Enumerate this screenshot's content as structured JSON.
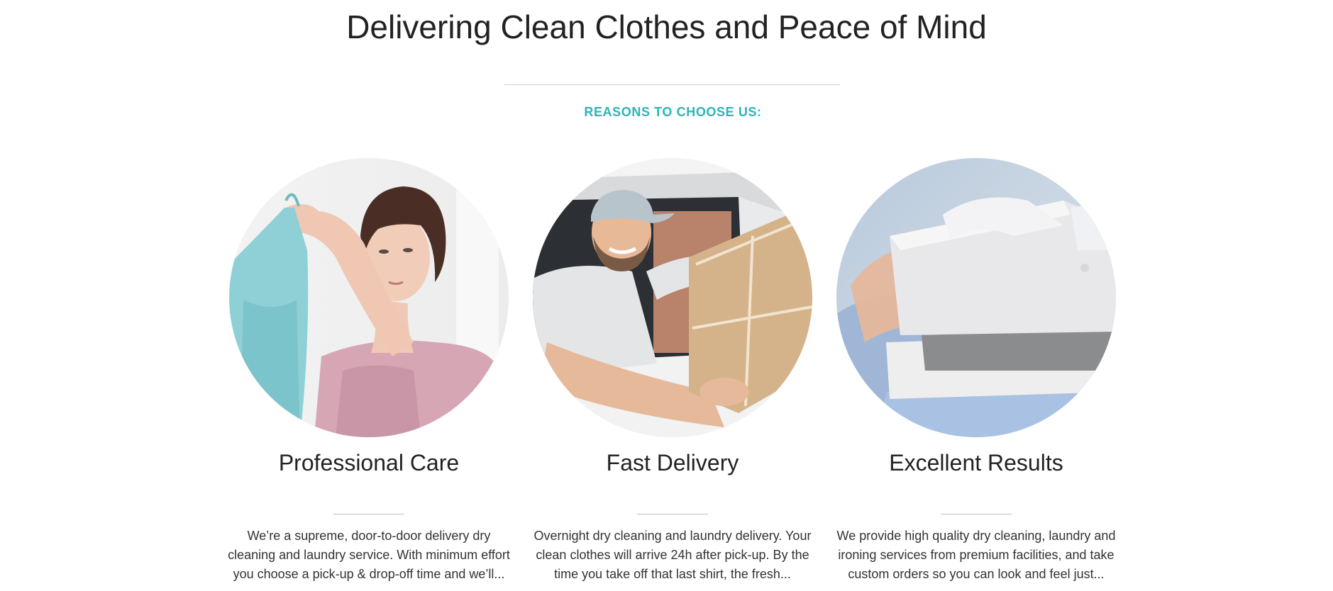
{
  "section": {
    "title": "Delivering Clean Clothes and Peace of Mind",
    "subtitle": "REASONS TO CHOOSE US:"
  },
  "features": [
    {
      "title": "Professional Care",
      "text": "We’re a supreme, door-to-door delivery dry cleaning and laundry service. With minimum effort you choose a pick-up & drop-off time and we’ll...",
      "image": "woman-holding-blue-dress-photo"
    },
    {
      "title": "Fast Delivery",
      "text": "Overnight dry cleaning and laundry delivery. Your clean clothes will arrive 24h after pick-up. By the time you take off that last shirt, the fresh...",
      "image": "delivery-driver-with-package-photo"
    },
    {
      "title": "Excellent Results",
      "text": "We provide high quality dry cleaning, laundry and ironing services from premium facilities, and take custom orders so you can look and feel just...",
      "image": "folded-shirts-stack-photo"
    }
  ],
  "colors": {
    "accent": "#2bb5b8",
    "heading": "#222222",
    "body_text": "#333333",
    "rule": "#cfcfcf"
  }
}
